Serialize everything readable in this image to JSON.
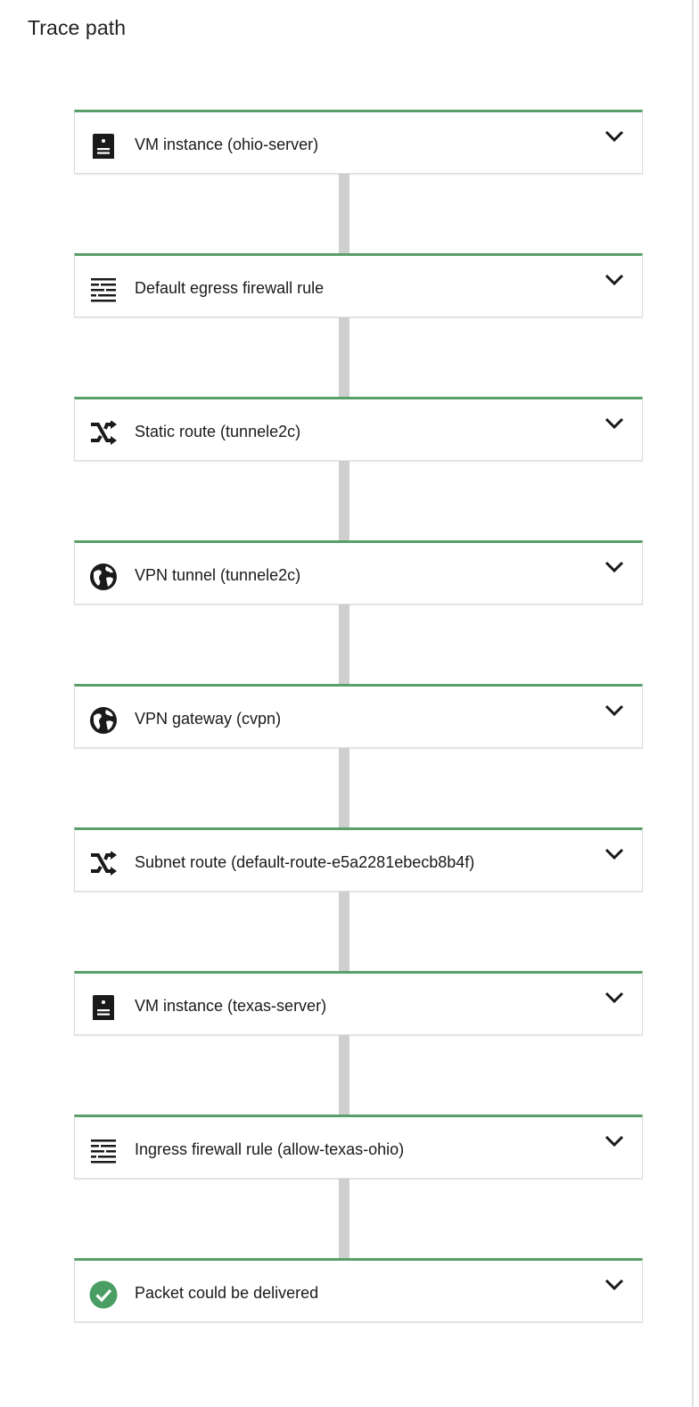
{
  "page": {
    "title": "Trace path"
  },
  "colors": {
    "accent_border": "#5a9e69",
    "connector": "#cfcfcf",
    "success": "#4a9e64"
  },
  "steps": [
    {
      "label": "VM instance (ohio-server)",
      "icon": "vm-instance-icon"
    },
    {
      "label": "Default egress firewall rule",
      "icon": "firewall-icon"
    },
    {
      "label": "Static route (tunnele2c)",
      "icon": "route-icon"
    },
    {
      "label": "VPN tunnel (tunnele2c)",
      "icon": "globe-icon"
    },
    {
      "label": "VPN gateway (cvpn)",
      "icon": "globe-icon"
    },
    {
      "label": "Subnet route (default-route-e5a2281ebecb8b4f)",
      "icon": "route-icon"
    },
    {
      "label": "VM instance (texas-server)",
      "icon": "vm-instance-icon"
    },
    {
      "label": "Ingress firewall rule (allow-texas-ohio)",
      "icon": "firewall-icon"
    },
    {
      "label": "Packet could be delivered",
      "icon": "check-circle-icon"
    }
  ]
}
